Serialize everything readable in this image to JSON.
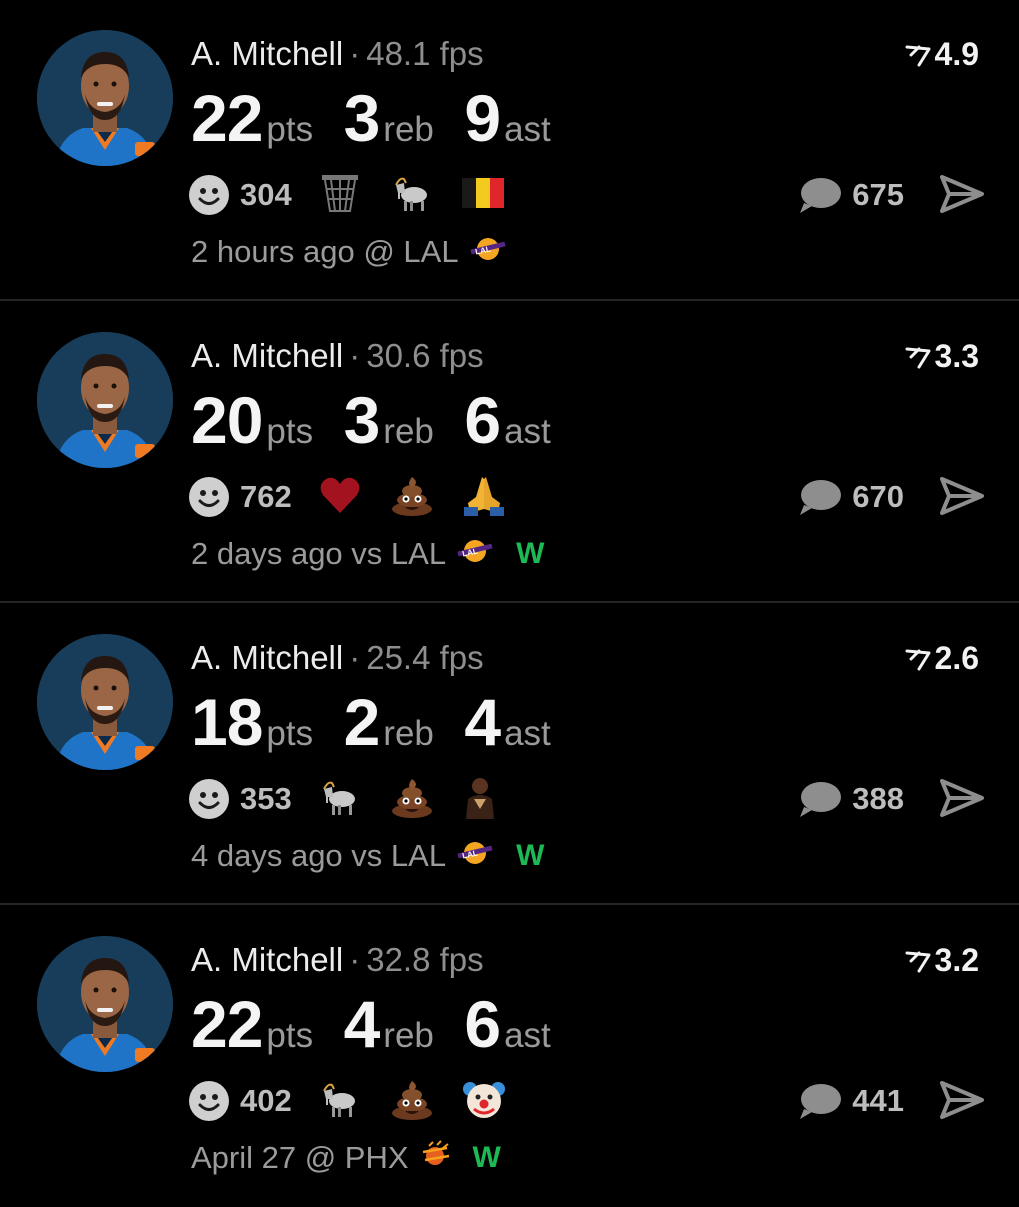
{
  "colors": {
    "background": "#000000",
    "win": "#1db954",
    "secondary_text": "#9b9b9b",
    "divider": "#262626"
  },
  "posts": [
    {
      "player": "A. Mitchell",
      "separator": "·",
      "fps": "48.1 fps",
      "rating": "4.9",
      "stats": [
        {
          "value": "22",
          "unit": "pts"
        },
        {
          "value": "3",
          "unit": "reb"
        },
        {
          "value": "9",
          "unit": "ast"
        }
      ],
      "reaction_count": "304",
      "reactions": [
        "basketball-net-icon",
        "goat-icon",
        "belgium-flag-icon"
      ],
      "comment_count": "675",
      "meta": "2 hours ago @ LAL",
      "opponent_logo": "lakers-logo-icon",
      "result": ""
    },
    {
      "player": "A. Mitchell",
      "separator": "·",
      "fps": "30.6 fps",
      "rating": "3.3",
      "stats": [
        {
          "value": "20",
          "unit": "pts"
        },
        {
          "value": "3",
          "unit": "reb"
        },
        {
          "value": "6",
          "unit": "ast"
        }
      ],
      "reaction_count": "762",
      "reactions": [
        "red-heart-icon",
        "poop-icon",
        "praying-hands-icon"
      ],
      "comment_count": "670",
      "meta": "2 days ago vs LAL",
      "opponent_logo": "lakers-logo-icon",
      "result": "W"
    },
    {
      "player": "A. Mitchell",
      "separator": "·",
      "fps": "25.4 fps",
      "rating": "2.6",
      "stats": [
        {
          "value": "18",
          "unit": "pts"
        },
        {
          "value": "2",
          "unit": "reb"
        },
        {
          "value": "4",
          "unit": "ast"
        }
      ],
      "reaction_count": "353",
      "reactions": [
        "goat-icon",
        "poop-icon",
        "player-sticker-icon"
      ],
      "comment_count": "388",
      "meta": "4 days ago vs LAL",
      "opponent_logo": "lakers-logo-icon",
      "result": "W"
    },
    {
      "player": "A. Mitchell",
      "separator": "·",
      "fps": "32.8 fps",
      "rating": "3.2",
      "stats": [
        {
          "value": "22",
          "unit": "pts"
        },
        {
          "value": "4",
          "unit": "reb"
        },
        {
          "value": "6",
          "unit": "ast"
        }
      ],
      "reaction_count": "402",
      "reactions": [
        "goat-icon",
        "poop-icon",
        "clown-face-icon"
      ],
      "comment_count": "441",
      "meta": "April 27 @ PHX",
      "opponent_logo": "suns-logo-icon",
      "result": "W"
    }
  ]
}
